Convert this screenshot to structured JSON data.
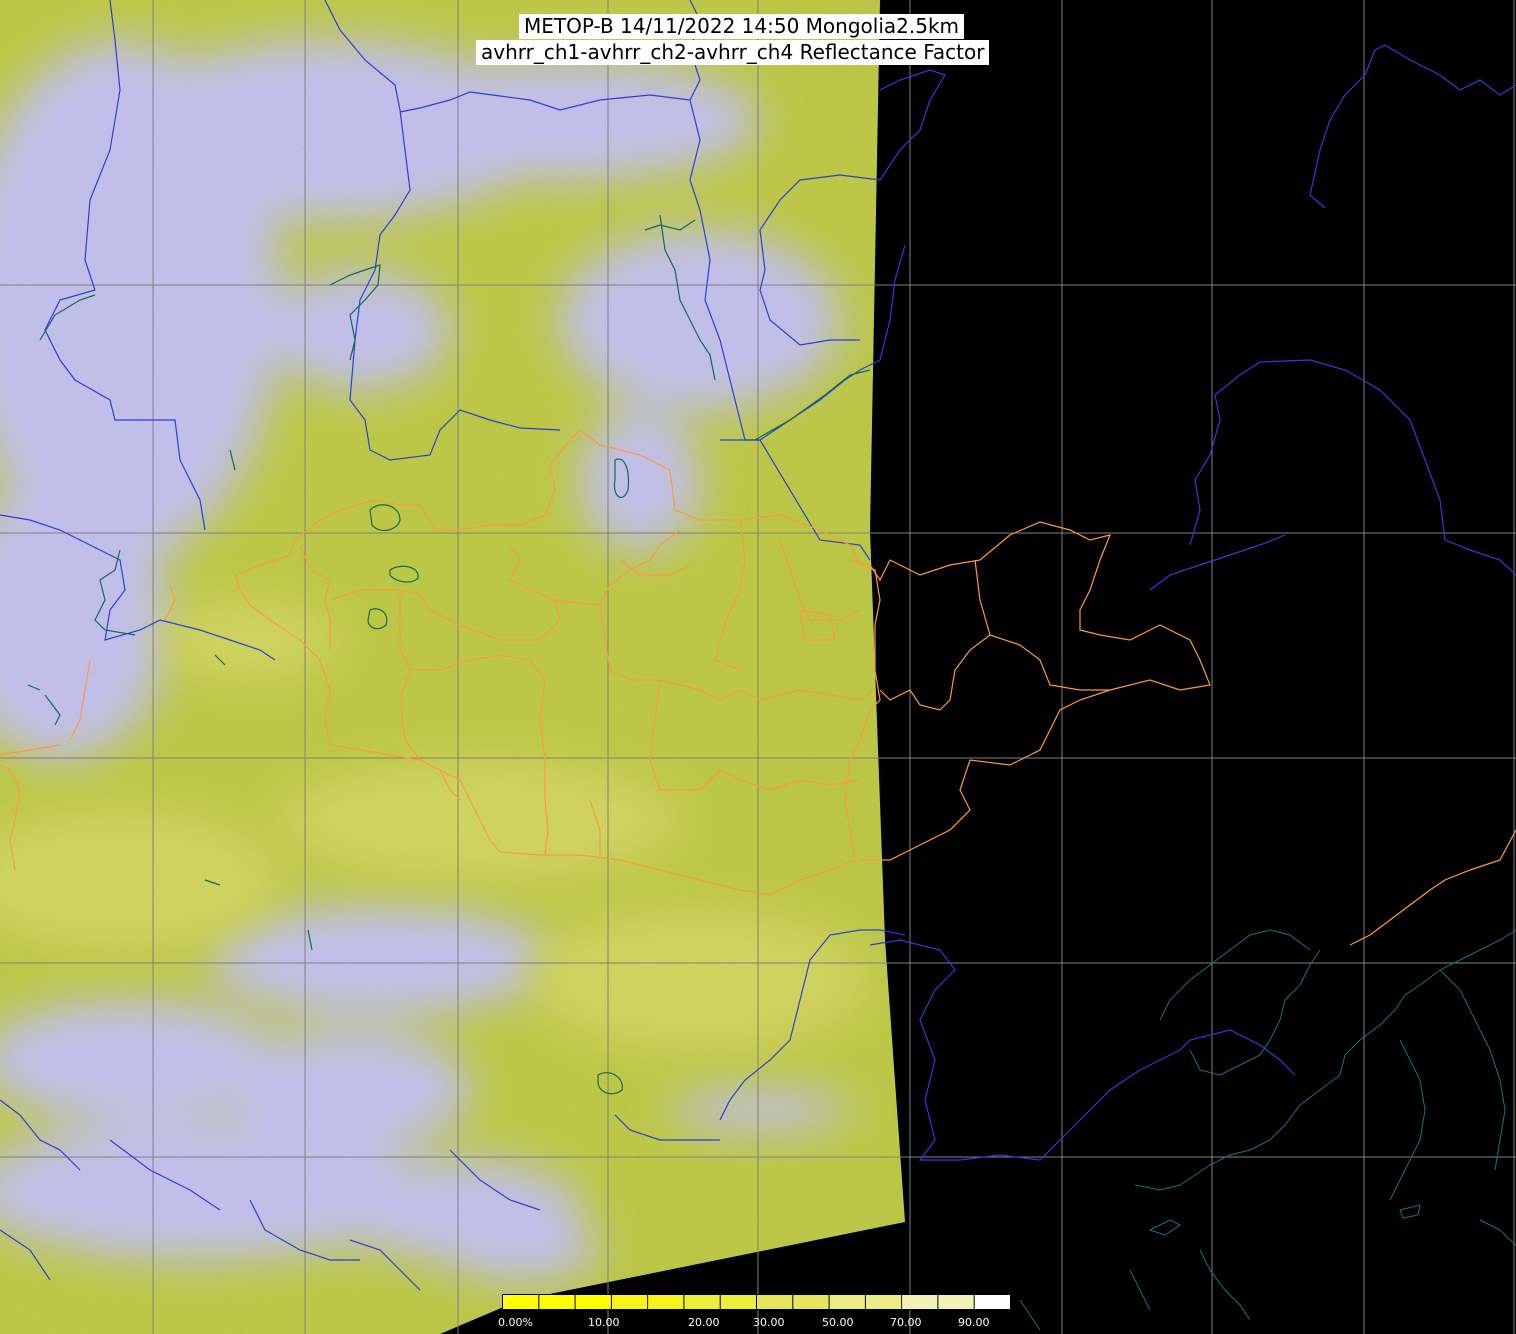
{
  "title": {
    "line1": "METOP-B 14/11/2022 14:50 Mongolia2.5km",
    "line2": "avhrr_ch1-avhrr_ch2-avhrr_ch4 Reflectance Factor"
  },
  "colorbar": {
    "labels": [
      "0.00%",
      "10.00",
      "20.00",
      "30.00",
      "50.00",
      "70.00",
      "90.00"
    ],
    "colors": [
      "#ffff00",
      "#f4f41a",
      "#eded3c",
      "#e6e65a",
      "#ecec86",
      "#f2f2b6",
      "#ffffff"
    ]
  },
  "colors": {
    "background": "#000000",
    "land_surface": "#c3cf3e",
    "cloud": "#c8c6f2",
    "grid": "#808080",
    "border_province": "#ff9a3c",
    "coastline_lake": "#2b3fd6",
    "river": "#0f6a5a",
    "coast_east": "#1f6f82"
  }
}
